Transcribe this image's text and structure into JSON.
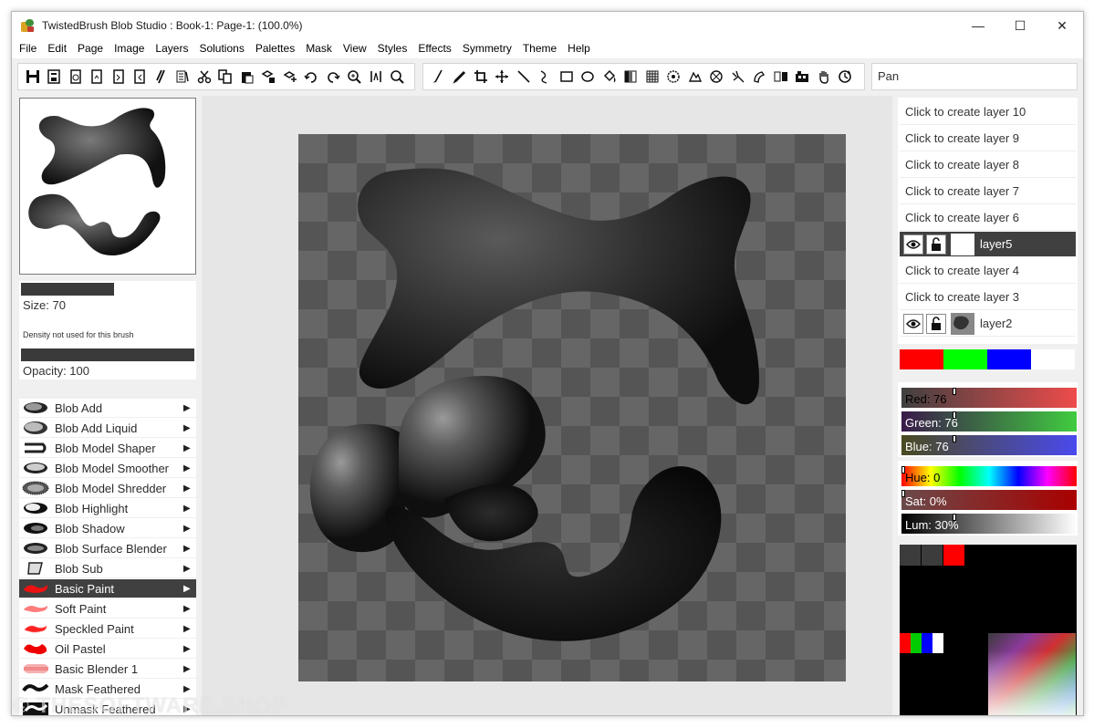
{
  "window": {
    "title": "TwistedBrush Blob Studio : Book-1: Page-1:  (100.0%)",
    "controls": [
      "—",
      "☐",
      "✕"
    ]
  },
  "menu": [
    "File",
    "Edit",
    "Page",
    "Image",
    "Layers",
    "Solutions",
    "Palettes",
    "Mask",
    "View",
    "Styles",
    "Effects",
    "Symmetry",
    "Theme",
    "Help"
  ],
  "toolbar": {
    "current_tool_label": "Pan"
  },
  "brush_settings": {
    "size_label": "Size: 70",
    "density_label": "Density not used for this brush",
    "opacity_label": "Opacity: 100"
  },
  "brushes": [
    {
      "label": "Blob Add",
      "selected": false
    },
    {
      "label": "Blob Add Liquid",
      "selected": false
    },
    {
      "label": "Blob Model Shaper",
      "selected": false
    },
    {
      "label": "Blob Model Smoother",
      "selected": false
    },
    {
      "label": "Blob Model Shredder",
      "selected": false
    },
    {
      "label": "Blob Highlight",
      "selected": false
    },
    {
      "label": "Blob Shadow",
      "selected": false
    },
    {
      "label": "Blob Surface Blender",
      "selected": false
    },
    {
      "label": "Blob Sub",
      "selected": false
    },
    {
      "label": "Basic Paint",
      "selected": true
    },
    {
      "label": "Soft Paint",
      "selected": false
    },
    {
      "label": "Speckled Paint",
      "selected": false
    },
    {
      "label": "Oil Pastel",
      "selected": false
    },
    {
      "label": "Basic Blender 1",
      "selected": false
    },
    {
      "label": "Mask Feathered",
      "selected": false
    },
    {
      "label": "Unmask Feathered",
      "selected": false
    }
  ],
  "layers": [
    {
      "label": "Click to create layer 10",
      "type": "empty"
    },
    {
      "label": "Click to create layer 9",
      "type": "empty"
    },
    {
      "label": "Click to create layer 8",
      "type": "empty"
    },
    {
      "label": "Click to create layer 7",
      "type": "empty"
    },
    {
      "label": "Click to create layer 6",
      "type": "empty"
    },
    {
      "label": "layer5",
      "type": "active"
    },
    {
      "label": "Click to create layer 4",
      "type": "empty"
    },
    {
      "label": "Click to create layer 3",
      "type": "empty"
    },
    {
      "label": "layer2",
      "type": "normal"
    }
  ],
  "palette_strip": [
    "#ff0000",
    "#00ff00",
    "#0000ff",
    "#ffffff"
  ],
  "color": {
    "red_label": "Red: 76",
    "green_label": "Green: 76",
    "blue_label": "Blue: 76",
    "hue_label": "Hue: 0",
    "sat_label": "Sat: 0%",
    "lum_label": "Lum: 30%",
    "red": 76,
    "green": 76,
    "blue": 76,
    "hue": 0,
    "sat": 0,
    "lum": 30
  },
  "swatches": {
    "top": [
      "#3c3c3c",
      "#3c3c3c",
      "#ff0000"
    ],
    "small": [
      "#ff0000",
      "#00cc00",
      "#0000ff",
      "#ffffff"
    ]
  },
  "watermark": "© THESOFTWARE.SHOP"
}
